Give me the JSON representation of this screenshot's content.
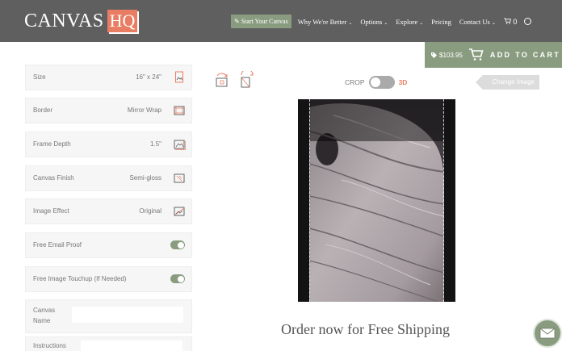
{
  "brand": {
    "name": "CANVAS",
    "badge": "HQ"
  },
  "nav": {
    "start": "✎ Start Your Canvas",
    "items": [
      {
        "label": "Why We're Better",
        "chevron": true
      },
      {
        "label": "Options",
        "chevron": true
      },
      {
        "label": "Explore",
        "chevron": true
      },
      {
        "label": "Pricing",
        "chevron": false
      },
      {
        "label": "Contact Us",
        "chevron": true
      }
    ],
    "cart_count": "0",
    "chevron_glyph": "⌄"
  },
  "cart": {
    "price": "$103.95",
    "label": "ADD TO CART"
  },
  "options": [
    {
      "label": "Size",
      "value": "16\" x 24\"",
      "icon": "size-icon"
    },
    {
      "label": "Border",
      "value": "Mirror Wrap",
      "icon": "border-icon"
    },
    {
      "label": "Frame Depth",
      "value": "1.5\"",
      "icon": "frame-depth-icon"
    },
    {
      "label": "Canvas Finish",
      "value": "Semi-gloss",
      "icon": "finish-icon"
    },
    {
      "label": "Image Effect",
      "value": "Original",
      "icon": "effect-icon"
    }
  ],
  "toggles": [
    {
      "label": "Free Email Proof",
      "on": true
    },
    {
      "label": "Free Image Touchup (If Needed)",
      "on": true
    }
  ],
  "fields": {
    "canvas_name_label": "Canvas Name",
    "instructions_label": "Instructions"
  },
  "editor": {
    "crop_label": "CROP",
    "mode_3d_label": "3D",
    "change_image": "Change Image"
  },
  "promo": "Order now for Free Shipping",
  "colors": {
    "header": "#5f5f5f",
    "accent_green": "#8a9c80",
    "accent_orange": "#e97d63"
  }
}
